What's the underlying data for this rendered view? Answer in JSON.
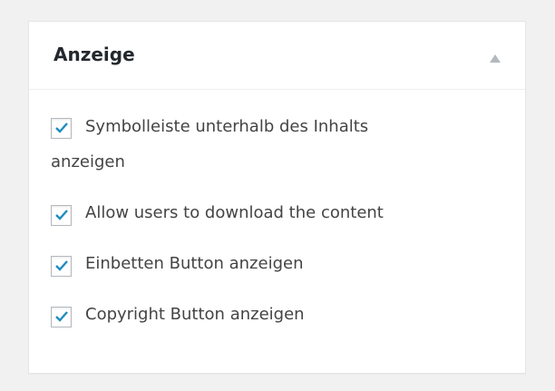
{
  "panel": {
    "title": "Anzeige",
    "toggle_icon": "triangle-up-icon",
    "options": [
      {
        "label_line1": "Symbolleiste unterhalb des Inhalts",
        "label_line2": "anzeigen",
        "checked": true
      },
      {
        "label": "Allow users to download the content",
        "checked": true
      },
      {
        "label": "Einbetten Button anzeigen",
        "checked": true
      },
      {
        "label": "Copyright Button anzeigen",
        "checked": true
      }
    ]
  },
  "colors": {
    "background": "#f1f1f1",
    "panel": "#ffffff",
    "title": "#23282d",
    "text": "#444444",
    "checkmark": "#1e8cbe"
  }
}
